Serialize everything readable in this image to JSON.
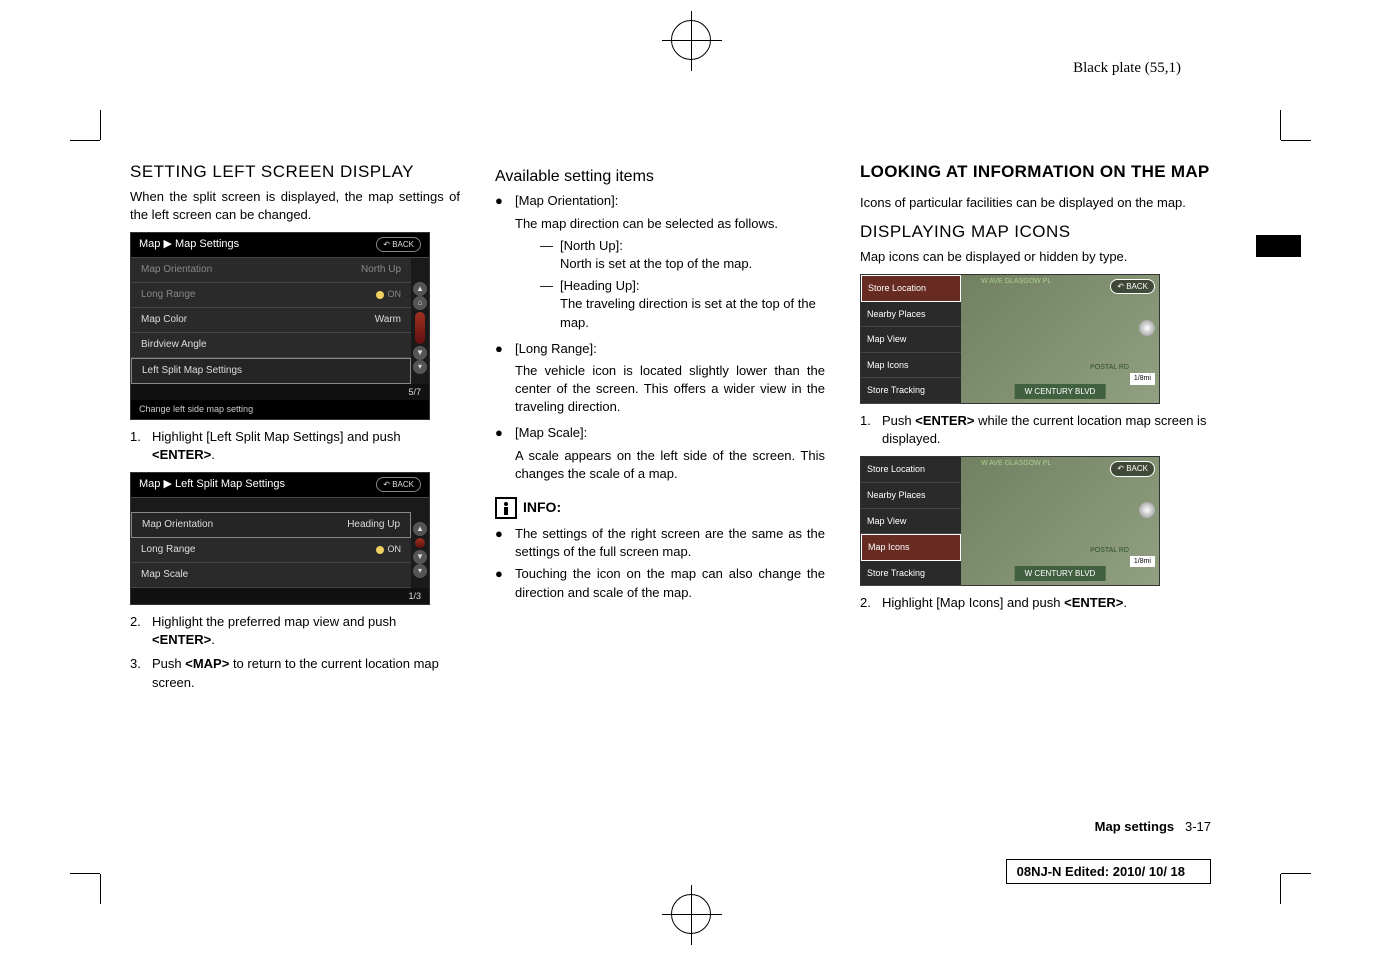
{
  "header": {
    "plate": "Black plate (55,1)"
  },
  "col1": {
    "heading": "SETTING LEFT SCREEN DISPLAY",
    "intro": "When the split screen is displayed, the map settings of the left screen can be changed.",
    "ss1": {
      "title": "Map ▶ Map Settings",
      "back": "↶ BACK",
      "rows": [
        {
          "label": "Map Orientation",
          "value": "North Up"
        },
        {
          "label": "Long Range",
          "value": "ON"
        },
        {
          "label": "Map Color",
          "value": "Warm"
        },
        {
          "label": "Birdview Angle",
          "value": ""
        },
        {
          "label": "Left Split Map Settings",
          "value": ""
        }
      ],
      "page": "5/7",
      "caption": "Change left side map setting"
    },
    "step1_n": "1.",
    "step1": "Highlight [Left Split Map Settings] and push <ENTER>.",
    "ss2": {
      "title": "Map ▶ Left Split Map Settings",
      "back": "↶ BACK",
      "rows": [
        {
          "label": "Map Orientation",
          "value": "Heading Up"
        },
        {
          "label": "Long Range",
          "value": "ON"
        },
        {
          "label": "Map Scale",
          "value": ""
        }
      ],
      "page": "1/3"
    },
    "step2_n": "2.",
    "step2": "Highlight the preferred map view and push <ENTER>.",
    "step3_n": "3.",
    "step3": "Push <MAP> to return to the current location map screen."
  },
  "col2": {
    "heading": "Available setting items",
    "bullets": [
      {
        "label": "[Map Orientation]:",
        "desc": "The map direction can be selected as follows.",
        "sub": [
          {
            "label": "[North Up]:",
            "desc": "North is set at the top of the map."
          },
          {
            "label": "[Heading Up]:",
            "desc": "The traveling direction is set at the top of the map."
          }
        ]
      },
      {
        "label": "[Long Range]:",
        "desc": "The vehicle icon is located slightly lower than the center of the screen. This offers a wider view in the traveling direction."
      },
      {
        "label": "[Map Scale]:",
        "desc": "A scale appears on the left side of the screen. This changes the scale of a map."
      }
    ],
    "info_label": "INFO:",
    "info_bullets": [
      "The settings of the right screen are the same as the settings of the full screen map.",
      "Touching the icon on the map can also change the direction and scale of the map."
    ]
  },
  "col3": {
    "main_heading": "LOOKING AT INFORMATION ON THE MAP",
    "intro": "Icons of particular facilities can be displayed on the map.",
    "sub_heading": "DISPLAYING MAP ICONS",
    "sub_intro": "Map icons can be displayed or hidden by type.",
    "map_menu": [
      "Store Location",
      "Nearby Places",
      "Map View",
      "Map Icons",
      "Store Tracking"
    ],
    "map_back": "↶ BACK",
    "map_top": "W AVE   GLASGOW PL",
    "map_road": "W CENTURY BLVD",
    "map_postal": "POSTAL RD",
    "map_dist": "1/8mi",
    "step1_n": "1.",
    "step1": "Push <ENTER> while the current location map screen is displayed.",
    "step2_n": "2.",
    "step2": "Highlight [Map Icons] and push <ENTER>."
  },
  "footer": {
    "page_label": "Map settings",
    "page_num": "3-17",
    "edition": "08NJ-N Edited:  2010/ 10/ 18"
  }
}
